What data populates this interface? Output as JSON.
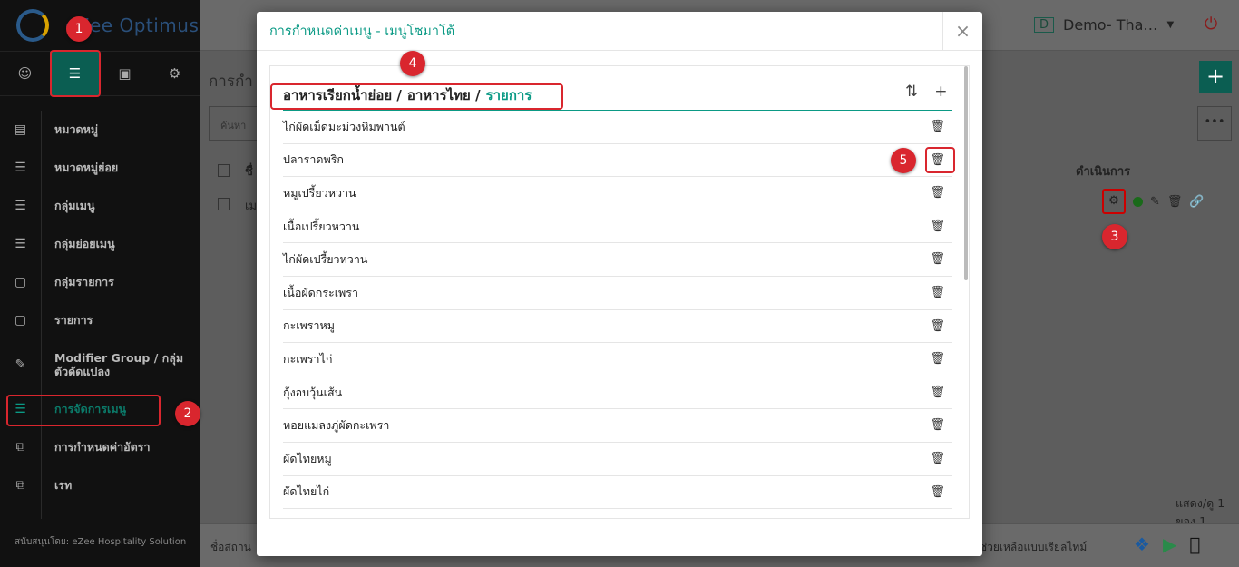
{
  "brand": {
    "name": "eZee Optimus"
  },
  "sidebar": {
    "tabs": [
      "user-icon",
      "menu-icon",
      "cart-icon",
      "gear-icon"
    ],
    "items": [
      {
        "label": "หมวดหมู่",
        "icon": "server-icon"
      },
      {
        "label": "หมวดหมู่ย่อย",
        "icon": "list-icon"
      },
      {
        "label": "กลุ่มเมนู",
        "icon": "list-icon"
      },
      {
        "label": "กลุ่มย่อยเมนู",
        "icon": "list-icon"
      },
      {
        "label": "กลุ่มรายการ",
        "icon": "box-icon"
      },
      {
        "label": "รายการ",
        "icon": "box-icon"
      },
      {
        "label": "Modifier Group / กลุ่มตัวดัดแปลง",
        "icon": "edit-icon"
      },
      {
        "label": "การจัดการเมนู",
        "icon": "menu-icon",
        "active": true
      },
      {
        "label": "การกำหนดค่าอัตรา",
        "icon": "copy-icon"
      },
      {
        "label": "เรท",
        "icon": "copy-icon"
      }
    ],
    "footer": "สนับสนุนโดย: eZee Hospitality Solution"
  },
  "header": {
    "user_initial": "D",
    "user_name": "Demo- Tha…"
  },
  "main": {
    "page_title": "การกำ",
    "search_placeholder": "ค้นหา",
    "col_name": "ชื่",
    "row_name": "เม",
    "action_header": "ดำเนินการ",
    "page_info": "แสดง/ดู 1 ของ 1",
    "footer_left": "ชื่อสถาน",
    "footer_right": "ช่วยเหลือแบบเรียลไทม์"
  },
  "modal": {
    "title": "การกำหนดค่าเมนู - เมนูโซมาโต้",
    "close": "×",
    "breadcrumb": [
      "อาหารเรียกน้ำย่อย /",
      "อาหารไทย /",
      "รายการ"
    ],
    "items": [
      "ไก่ผัดเม็ดมะม่วงหิมพานต์",
      "ปลาราดพริก",
      "หมูเปรี้ยวหวาน",
      "เนื้อเปรี้ยวหวาน",
      "ไก่ผัดเปรี้ยวหวาน",
      "เนื้อผัดกระเพรา",
      "กะเพราหมู",
      "กะเพราไก่",
      "กุ้งอบวุ้นเส้น",
      "หอยแมลงภู่ผัดกะเพรา",
      "ผัดไทยหมู",
      "ผัดไทยไก่"
    ]
  },
  "annotations": [
    "1",
    "2",
    "3",
    "4",
    "5"
  ],
  "colors": {
    "accent": "#0b9a85",
    "marker": "#d9262e",
    "sidebar_bg": "#111111"
  }
}
